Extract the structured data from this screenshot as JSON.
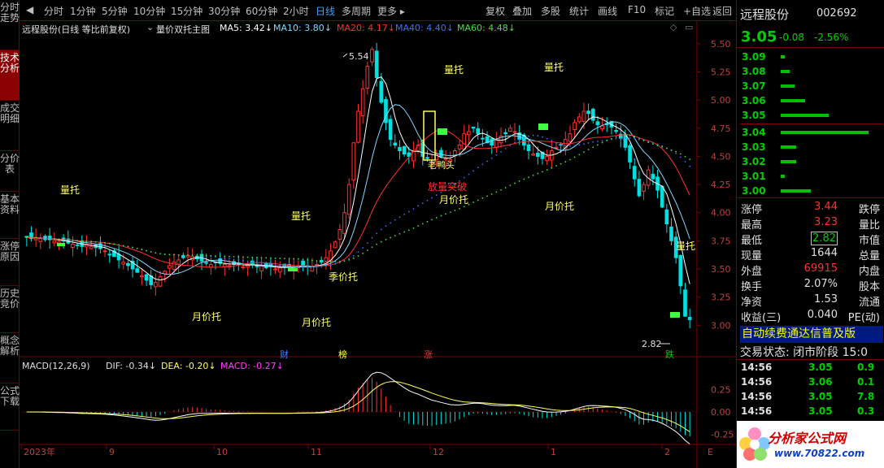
{
  "left_tabs": [
    {
      "label": "分时走势",
      "active": false
    },
    {
      "label": "技术分析",
      "active": true
    },
    {
      "label": "成交明细",
      "active": false
    },
    {
      "label": "分价表",
      "active": false
    },
    {
      "label": "基本资料",
      "active": false
    },
    {
      "label": "涨停原因",
      "active": false
    },
    {
      "label": "历史竞价",
      "active": false
    },
    {
      "label": "概念解析",
      "active": false
    },
    {
      "label": "公式下载",
      "active": false
    }
  ],
  "toolbar": {
    "back": "◀",
    "periods": [
      "分时",
      "1分钟",
      "5分钟",
      "10分钟",
      "15分钟",
      "30分钟",
      "60分钟",
      "2小时",
      "日线",
      "多周期",
      "更多 ▸"
    ],
    "active_period": "日线",
    "buttons": [
      "复权",
      "叠加",
      "多股",
      "统计",
      "画线",
      "F10",
      "标记",
      "+自选",
      "返回"
    ]
  },
  "chart": {
    "header": "远程股份(日线 等比前复权)",
    "indicator": "量价双托主图",
    "ma": [
      {
        "label": "MA5: 3.42↓",
        "color": "#ffffff"
      },
      {
        "label": "MA10: 3.80↓",
        "color": "#7fd8ff"
      },
      {
        "label": "MA20: 4.17↓",
        "color": "#ff3030"
      },
      {
        "label": "MA40: 4.40↓",
        "color": "#4070ff"
      },
      {
        "label": "MA60: 4.48↓",
        "color": "#40e040"
      }
    ],
    "y_ticks": [
      "5.50",
      "5.25",
      "5.00",
      "4.75",
      "4.50",
      "4.25",
      "4.00",
      "3.75",
      "3.50",
      "3.25",
      "3.00"
    ],
    "x_ticks": [
      "2023年",
      "9",
      "10",
      "11",
      "12",
      "1",
      "2"
    ],
    "high_label": "5.54",
    "low_label": "2.82",
    "annotations": [
      {
        "text": "量托",
        "color": "#ffff60"
      },
      {
        "text": "月价托",
        "color": "#ffff60"
      },
      {
        "text": "月价托",
        "color": "#ffff60"
      },
      {
        "text": "季价托",
        "color": "#ffff60"
      },
      {
        "text": "量托",
        "color": "#ffff60"
      },
      {
        "text": "量托",
        "color": "#ffff60"
      },
      {
        "text": "老鸭头",
        "color": "#ffff60"
      },
      {
        "text": "放量突破",
        "color": "#ff3030"
      },
      {
        "text": "月价托",
        "color": "#ffff60"
      },
      {
        "text": "量托",
        "color": "#ffff60"
      },
      {
        "text": "月价托",
        "color": "#ffff60"
      },
      {
        "text": "量托",
        "color": "#ffff60"
      }
    ],
    "markers": [
      "财",
      "榜",
      "涨",
      "跌"
    ],
    "macd": {
      "header": "MACD(12,26,9)",
      "dif": "DIF: -0.34↓",
      "dea": "DEA: -0.20↓",
      "macd": "MACD: -0.27↓",
      "y_ticks": [
        "0.25",
        "0.00",
        "-0.25"
      ]
    },
    "axis_suffix": "E"
  },
  "chart_data": {
    "type": "candlestick",
    "title": "远程股份(日线 等比前复权)",
    "x_ticks": [
      "2023年",
      "9",
      "10",
      "11",
      "12",
      "1",
      "2"
    ],
    "ylim": [
      2.8,
      5.6
    ],
    "close": [
      3.78,
      3.77,
      3.78,
      3.77,
      3.76,
      3.76,
      3.75,
      3.74,
      3.75,
      3.73,
      3.72,
      3.71,
      3.7,
      3.72,
      3.7,
      3.69,
      3.68,
      3.66,
      3.63,
      3.61,
      3.58,
      3.56,
      3.53,
      3.5,
      3.47,
      3.44,
      3.4,
      3.36,
      3.38,
      3.43,
      3.48,
      3.53,
      3.56,
      3.58,
      3.6,
      3.62,
      3.61,
      3.59,
      3.57,
      3.55,
      3.54,
      3.56,
      3.55,
      3.54,
      3.53,
      3.54,
      3.55,
      3.52,
      3.53,
      3.54,
      3.52,
      3.53,
      3.51,
      3.52,
      3.5,
      3.51,
      3.52,
      3.52,
      3.52,
      3.53,
      3.53,
      3.52,
      3.52,
      3.54,
      3.56,
      3.6,
      3.66,
      3.74,
      3.85,
      4.0,
      4.25,
      4.62,
      4.9,
      5.1,
      5.3,
      5.45,
      5.2,
      4.98,
      4.8,
      4.65,
      4.6,
      4.55,
      4.52,
      4.5,
      4.55,
      4.6,
      4.5,
      4.48,
      4.45,
      4.52,
      4.5,
      4.48,
      4.47,
      4.55,
      4.6,
      4.7,
      4.72,
      4.75,
      4.7,
      4.66,
      4.62,
      4.6,
      4.65,
      4.68,
      4.7,
      4.75,
      4.72,
      4.65,
      4.6,
      4.55,
      4.52,
      4.5,
      4.48,
      4.5,
      4.55,
      4.58,
      4.6,
      4.65,
      4.7,
      4.8,
      4.85,
      4.9,
      4.88,
      4.82,
      4.78,
      4.77,
      4.78,
      4.76,
      4.72,
      4.66,
      4.58,
      4.45,
      4.3,
      4.15,
      4.25,
      4.38,
      4.3,
      4.2,
      4.05,
      3.9,
      3.75,
      3.6,
      3.35,
      3.08,
      3.05
    ],
    "indicators": {
      "MA5": 3.42,
      "MA10": 3.8,
      "MA20": 4.17,
      "MA40": 4.4,
      "MA60": 4.48
    },
    "macd_indicators": {
      "DIF": -0.34,
      "DEA": -0.2,
      "MACD": -0.27
    }
  },
  "panel": {
    "name": "远程股份",
    "code": "002692",
    "price": "3.05",
    "change": "-0.08",
    "change_pct": "-2.56%",
    "order_book": [
      {
        "price": "3.09",
        "pct": 0.05
      },
      {
        "price": "3.08",
        "pct": 0.1
      },
      {
        "price": "3.07",
        "pct": 0.16
      },
      {
        "price": "3.06",
        "pct": 0.28
      },
      {
        "price": "3.05",
        "pct": 0.55
      },
      {
        "price": "3.04",
        "pct": 1.0
      },
      {
        "price": "3.03",
        "pct": 0.18
      },
      {
        "price": "3.02",
        "pct": 0.18
      },
      {
        "price": "3.01",
        "pct": 0.05
      },
      {
        "price": "3.00",
        "pct": 0.34
      }
    ],
    "info": [
      {
        "k": "涨停",
        "v": "3.44",
        "vc": "#ff3030",
        "k2": "跌停"
      },
      {
        "k": "最高",
        "v": "3.23",
        "vc": "#ff3030",
        "k2": "量比"
      },
      {
        "k": "最低",
        "v": "2.82",
        "vc": "#00d000",
        "k2": "市值"
      },
      {
        "k": "现量",
        "v": "1644",
        "vc": "#e0e0e0",
        "k2": "总量"
      },
      {
        "k": "外盘",
        "v": "69915",
        "vc": "#ff3030",
        "k2": "内盘"
      },
      {
        "k": "换手",
        "v": "2.07%",
        "vc": "#e0e0e0",
        "k2": "股本"
      },
      {
        "k": "净资",
        "v": "1.53",
        "vc": "#e0e0e0",
        "k2": "流通"
      },
      {
        "k": "收益(三)",
        "v": "0.040",
        "vc": "#e0e0e0",
        "k2": "PE(动)"
      }
    ],
    "ticker": "自动续费通达信普及版",
    "status": "交易状态: 闭市阶段 15:0",
    "trades": [
      {
        "t": "14:56",
        "p": "3.05",
        "v": "0.9"
      },
      {
        "t": "14:56",
        "p": "3.06",
        "v": "0.1"
      },
      {
        "t": "14:56",
        "p": "3.05",
        "v": "7.8"
      },
      {
        "t": "14:56",
        "p": "3.05",
        "v": "0.3"
      }
    ],
    "logo_title": "分析家公式网",
    "logo_url": "www.70822.com"
  }
}
